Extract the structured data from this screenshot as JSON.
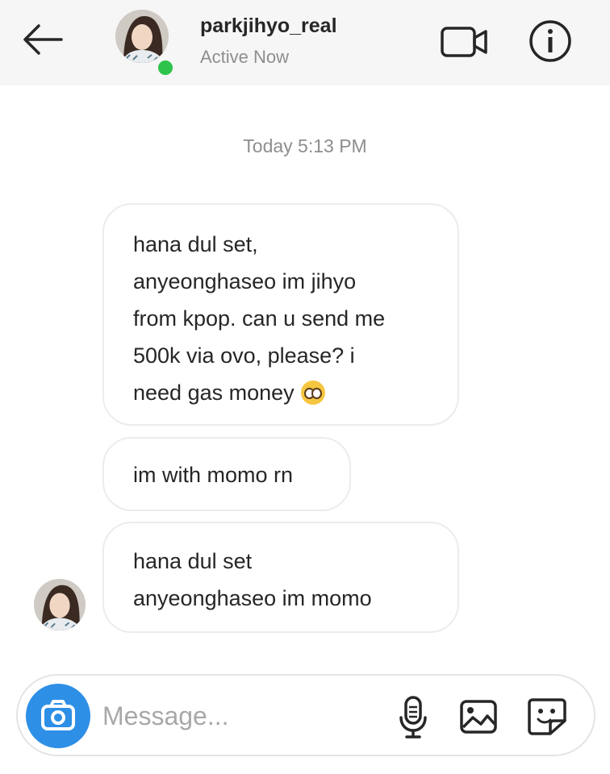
{
  "header": {
    "username": "parkjihyo_real",
    "status": "Active Now",
    "online_color": "#2ec44b",
    "icons": [
      "back-arrow-icon",
      "video-call-icon",
      "info-icon"
    ]
  },
  "chat": {
    "timestamp": "Today 5:13 PM",
    "messages": [
      {
        "lines": [
          "hana dul set,",
          "anyeonghaseo im jihyo",
          "from kpop. can u send me",
          "500k via ovo, please? i",
          "need gas money"
        ],
        "emoji": "pleading-face-emoji"
      },
      {
        "lines": [
          "im with momo rn"
        ]
      },
      {
        "lines": [
          "hana dul set",
          "anyeonghaseo im momo"
        ]
      }
    ]
  },
  "composer": {
    "placeholder": "Message...",
    "accent": "#2d8fe6",
    "icons": [
      "camera-icon",
      "microphone-icon",
      "gallery-icon",
      "sticker-icon"
    ]
  }
}
